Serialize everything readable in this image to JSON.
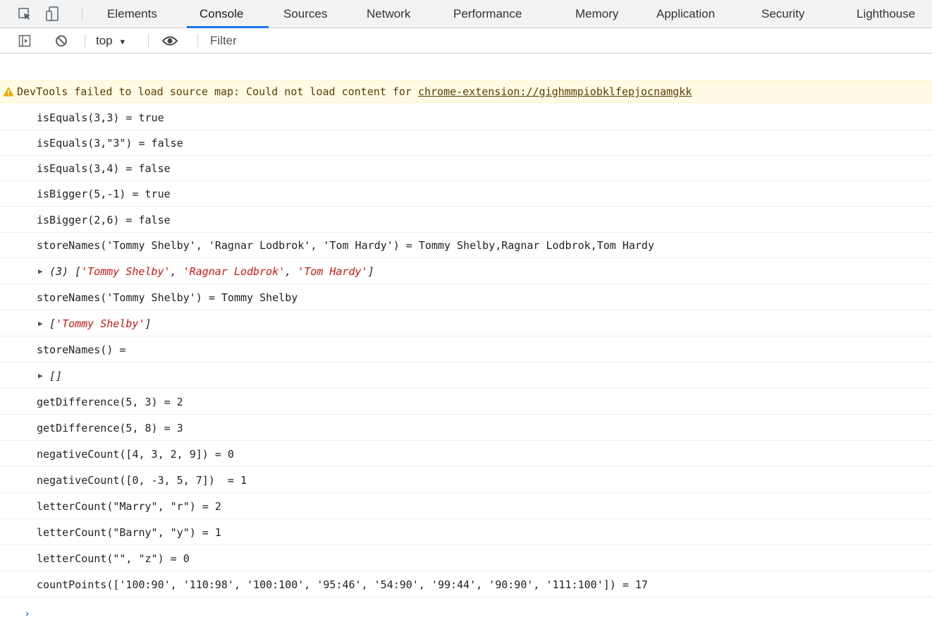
{
  "tabs": [
    {
      "label": "Elements"
    },
    {
      "label": "Console"
    },
    {
      "label": "Sources"
    },
    {
      "label": "Network"
    },
    {
      "label": "Performance"
    },
    {
      "label": "Memory"
    },
    {
      "label": "Application"
    },
    {
      "label": "Security"
    },
    {
      "label": "Lighthouse"
    }
  ],
  "active_tab": "Console",
  "toolbar": {
    "context": "top",
    "filter_placeholder": "Filter"
  },
  "warning": {
    "text": "DevTools failed to load source map: Could not load content for ",
    "link": "chrome-extension://gighmmpiobklfepjocnamgkk"
  },
  "log_lines": [
    "isEquals(3,3) = true",
    "isEquals(3,\"3\") = false",
    "isEquals(3,4) = false",
    "isBigger(5,-1) = true",
    "isBigger(2,6) = false",
    "storeNames('Tommy Shelby', 'Ragnar Lodbrok', 'Tom Hardy') = Tommy Shelby,Ragnar Lodbrok,Tom Hardy",
    "storeNames('Tommy Shelby') = Tommy Shelby",
    "storeNames() = ",
    "getDifference(5, 3) = 2",
    "getDifference(5, 8) = 3",
    "negativeCount([4, 3, 2, 9]) = 0",
    "negativeCount([0, -3, 5, 7])  = 1",
    "letterCount(\"Marry\", \"r\") = 2",
    "letterCount(\"Barny\", \"y\") = 1",
    "letterCount(\"\", \"z\") = 0",
    "countPoints(['100:90', '110:98', '100:100', '95:46', '54:90', '99:44', '90:90', '111:100']) = 17"
  ],
  "objects": {
    "arr1_prefix": "(3) [",
    "arr1_items": [
      "'Tommy Shelby'",
      "'Ragnar Lodbrok'",
      "'Tom Hardy'"
    ],
    "arr1_sep": ", ",
    "arr1_suffix": "]",
    "arr2_prefix": "[",
    "arr2_item": "'Tommy Shelby'",
    "arr2_suffix": "]",
    "arr3": "[]"
  },
  "prompt_symbol": "›"
}
